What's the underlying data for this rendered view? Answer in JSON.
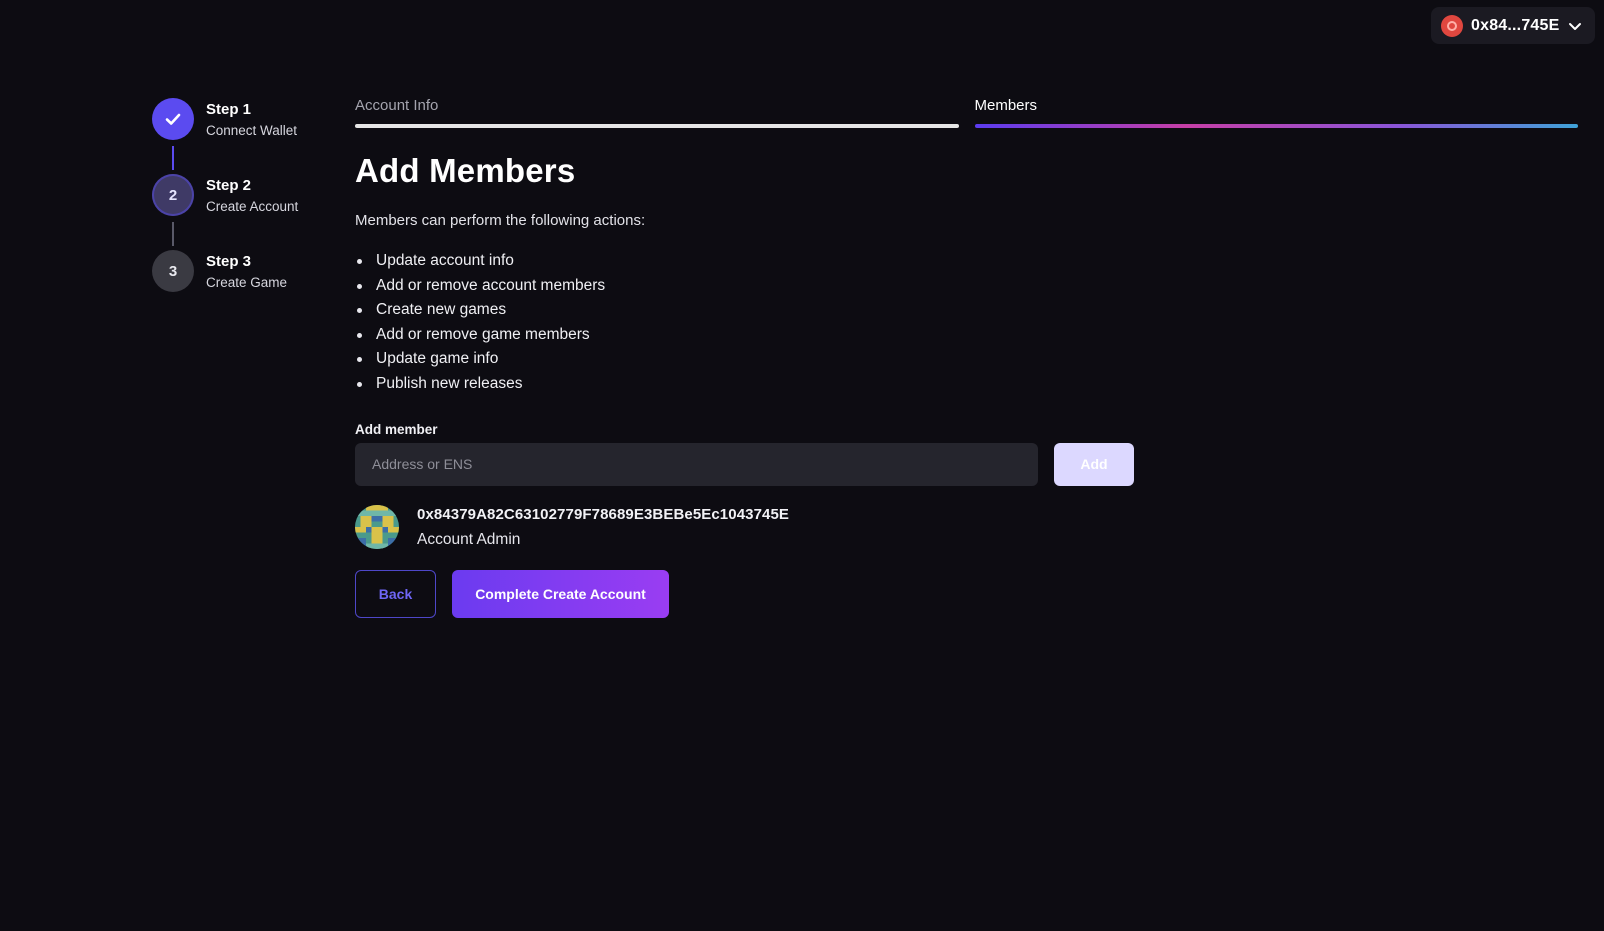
{
  "wallet": {
    "address_short": "0x84...745E",
    "avatar_icon": "wallet-identicon",
    "chevron_icon": "chevron-down-icon"
  },
  "stepper": {
    "steps": [
      {
        "title": "Step 1",
        "subtitle": "Connect Wallet",
        "state": "done",
        "number": ""
      },
      {
        "title": "Step 2",
        "subtitle": "Create Account",
        "state": "active",
        "number": "2"
      },
      {
        "title": "Step 3",
        "subtitle": "Create Game",
        "state": "todo",
        "number": "3"
      }
    ]
  },
  "tabs": [
    {
      "label": "Account Info",
      "active": false
    },
    {
      "label": "Members",
      "active": true
    }
  ],
  "main": {
    "title": "Add Members",
    "description": "Members can perform the following actions:",
    "actions": [
      "Update account info",
      "Add or remove account members",
      "Create new games",
      "Add or remove game members",
      "Update game info",
      "Publish new releases"
    ],
    "add_member": {
      "label": "Add member",
      "placeholder": "Address or ENS",
      "value": "",
      "button_label": "Add"
    },
    "member": {
      "address": "0x84379A82C63102779F78689E3BEBe5Ec1043745E",
      "role": "Account Admin"
    },
    "buttons": {
      "back_label": "Back",
      "complete_label": "Complete Create Account"
    }
  },
  "colors": {
    "background": "#0d0c12",
    "accent": "#5b4bf0",
    "primary_button": "#7a3cf1",
    "add_button": "#dcd8ff"
  }
}
